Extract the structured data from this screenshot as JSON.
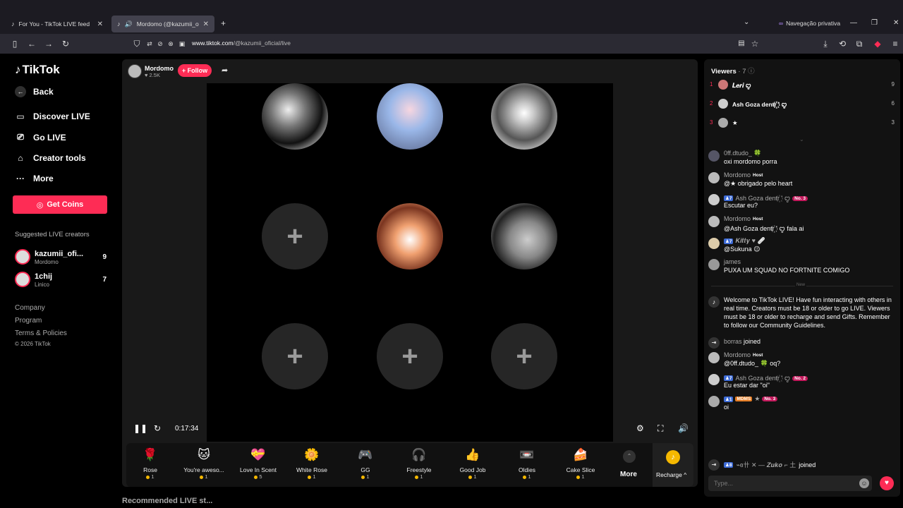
{
  "browser": {
    "tabs": [
      {
        "title": "For You - TikTok LIVE feed"
      },
      {
        "title": "Mordomo (@kazumii_ofic"
      }
    ],
    "private_label": "Navegação privativa",
    "url_host": "www.tiktok.com",
    "url_path": "/@kazumii_oficial/live"
  },
  "sidebar": {
    "logo": "TikTok",
    "back": "Back",
    "nav": [
      {
        "label": "Discover LIVE",
        "icon": "discover-icon"
      },
      {
        "label": "Go LIVE",
        "icon": "camera-icon"
      },
      {
        "label": "Creator tools",
        "icon": "home-icon"
      },
      {
        "label": "More",
        "icon": "ellipsis-icon"
      }
    ],
    "get_coins": "Get Coins",
    "suggested_title": "Suggested LIVE creators",
    "creators": [
      {
        "name": "kazumii_ofi...",
        "sub": "Mordomo",
        "count": "9"
      },
      {
        "name": "1chij",
        "sub": "Linico",
        "count": "7"
      }
    ],
    "footer": [
      "Company",
      "Program",
      "Terms & Policies",
      "© 2026 TikTok"
    ]
  },
  "player": {
    "host_name": "Mordomo",
    "host_likes": "2.5K",
    "follow": "+ Follow",
    "timer": "0:17:34",
    "gifts": [
      {
        "name": "Rose",
        "price": "1",
        "icon": "rose-icon",
        "glyph": "🌹"
      },
      {
        "name": "You're aweso...",
        "price": "1",
        "icon": "cat-icon",
        "glyph": "🐱"
      },
      {
        "name": "Love In Scent",
        "price": "5",
        "icon": "perfume-icon",
        "glyph": "💝"
      },
      {
        "name": "White Rose",
        "price": "1",
        "icon": "white-rose-icon",
        "glyph": "🌼"
      },
      {
        "name": "GG",
        "price": "1",
        "icon": "gg-icon",
        "glyph": "🎮"
      },
      {
        "name": "Freestyle",
        "price": "1",
        "icon": "freestyle-icon",
        "glyph": "🎧"
      },
      {
        "name": "Good Job",
        "price": "1",
        "icon": "thumbs-up-icon",
        "glyph": "👍"
      },
      {
        "name": "Oldies",
        "price": "1",
        "icon": "oldies-icon",
        "glyph": "📼"
      },
      {
        "name": "Cake Slice",
        "price": "1",
        "icon": "cake-icon",
        "glyph": "🍰"
      }
    ],
    "more": "More",
    "recharge": "Recharge ^"
  },
  "below_title": "Recommended LIVE st...",
  "chat": {
    "viewers_title": "Viewers",
    "viewers_count": "· 7",
    "top_viewers": [
      {
        "rank": "1",
        "name": "𝑳𝒆𝒓𝒊 ꨄ",
        "num": "9"
      },
      {
        "rank": "2",
        "name": "Ash Goza dentr꙰ ' ꨄ",
        "num": "6"
      },
      {
        "rank": "3",
        "name": "★",
        "num": "3"
      }
    ],
    "messages": [
      {
        "name": "0ff.dtudo_ 🍀",
        "text": "oxi mordomo porra"
      },
      {
        "name": "Mordomo",
        "host": "Host",
        "text": "@★ obrigado pelo heart"
      },
      {
        "name": "Ash Goza dentr꙰ ' ꨄ",
        "level": "7",
        "rank": "No. 3",
        "text": "Escutar eu?"
      },
      {
        "name": "Mordomo",
        "host": "Host",
        "text": "@Ash Goza dentr꙰ ' ꨄ fala ai"
      },
      {
        "name": "𝑲𝒊𝒕𝒕𝒚 ♥ 🩹",
        "level": "7",
        "text": "@Sukuna 😉"
      },
      {
        "name": "james",
        "text": "PUXA UM SQUAD NO FORTNITE COMIGO"
      }
    ],
    "divider": "New",
    "system": "Welcome to TikTok LIVE! Have fun interacting with others in real time. Creators must be 18 or older to go LIVE. Viewers must be 18 or older to recharge and send Gifts. Remember to follow our Community Guidelines.",
    "join1_name": "borras",
    "join1_text": "joined",
    "messages2": [
      {
        "name": "Mordomo",
        "host": "Host",
        "text": "@0ff.dtudo_ 🍀 oq?"
      },
      {
        "name": "Ash Goza dentr꙰ ' ꨄ",
        "level": "7",
        "rank": "No. 2",
        "text": "Eu estar dar \"oi\""
      },
      {
        "name": "★",
        "level": "1",
        "badge": "MDMS",
        "rank": "No. 3",
        "text": "oi"
      }
    ],
    "join2_level": "8",
    "join2_name": "⌁ɞ卄 ✕ — 𝒁𝒖𝒌𝒐 ⌐ 土",
    "join2_text": "joined",
    "input_placeholder": "Type...",
    "colors": {
      "accent": "#fe2c55",
      "coin": "#f5b800"
    }
  }
}
